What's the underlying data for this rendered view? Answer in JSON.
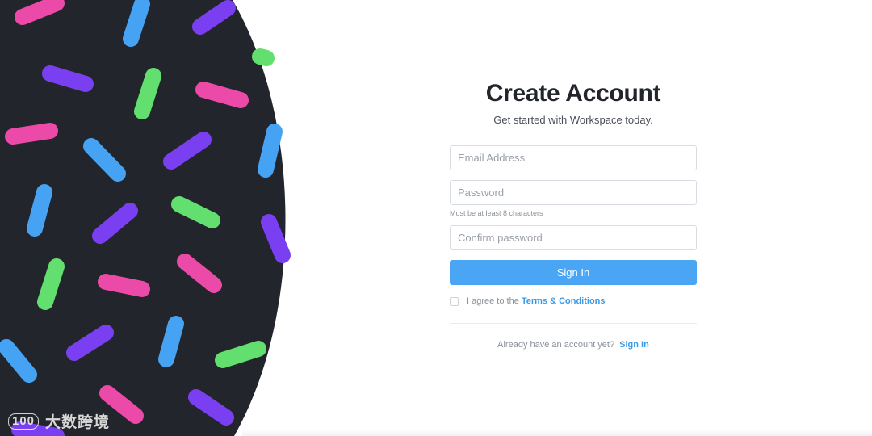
{
  "colors": {
    "panel_dark": "#22252b",
    "accent_blue": "#4aa5f5",
    "link_blue": "#3a9be6",
    "confetti_pink": "#ec4aa8",
    "confetti_purple": "#7b3ff2",
    "confetti_green": "#62df6e",
    "confetti_blue": "#46a3f3"
  },
  "form": {
    "title": "Create Account",
    "subtitle": "Get started with Workspace today.",
    "email_placeholder": "Email Address",
    "password_placeholder": "Password",
    "password_hint": "Must be at least 8 characters",
    "confirm_placeholder": "Confirm password",
    "submit_label": "Sign In",
    "agree_text": "I agree to the",
    "terms_link": "Terms & Conditions",
    "already_text": "Already have an account yet?",
    "signin_link": "Sign In"
  },
  "watermark": {
    "logo": "100",
    "text": "大数跨境"
  }
}
